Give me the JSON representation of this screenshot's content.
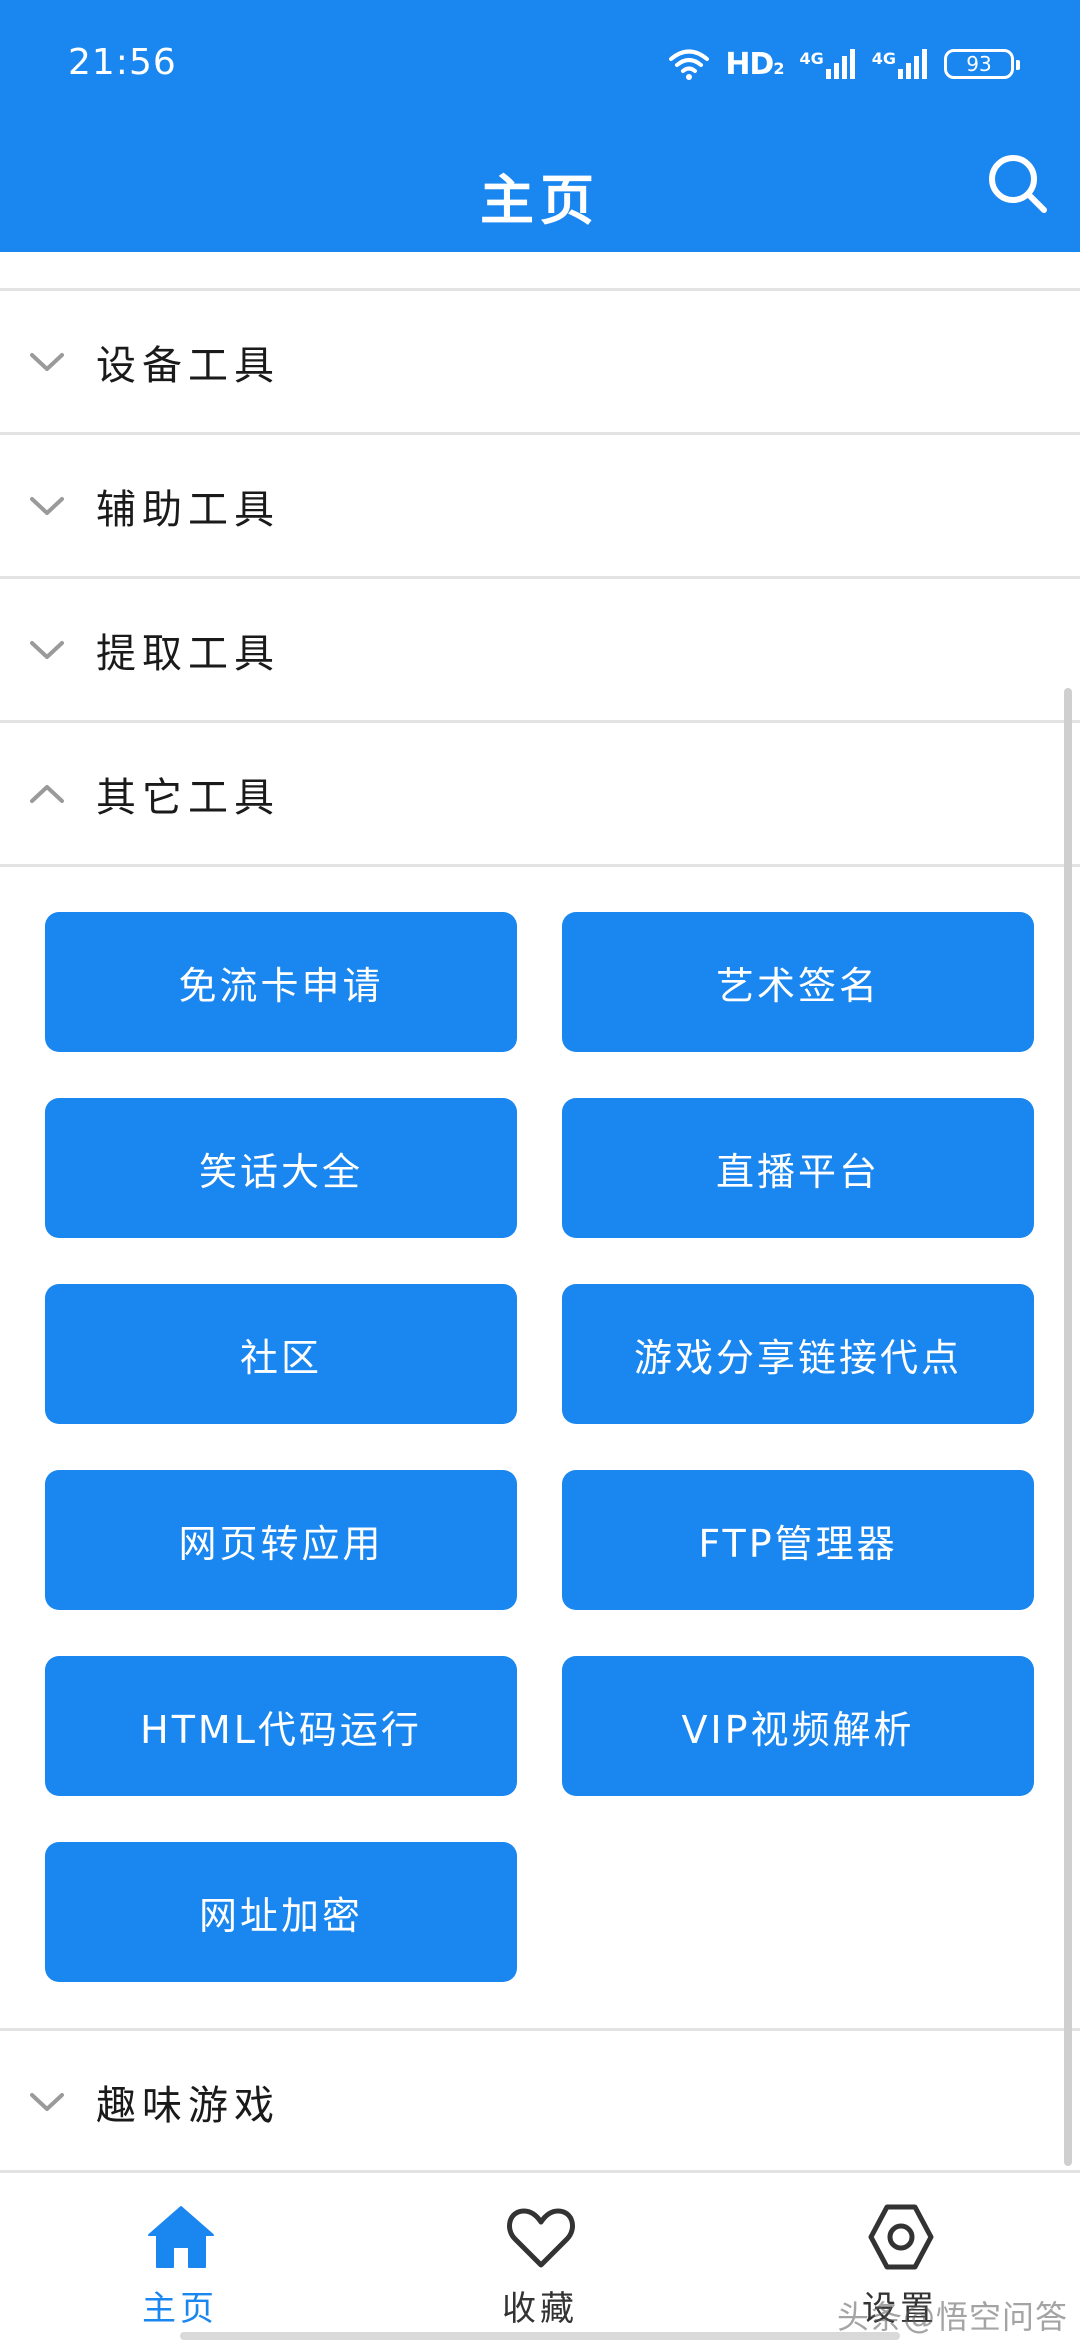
{
  "status_bar": {
    "time": "21:56",
    "network_label": "HD",
    "network_sub": "2",
    "signal_1": "4G",
    "signal_2": "4G",
    "battery": "93"
  },
  "header": {
    "title": "主页",
    "search_icon": "search-icon"
  },
  "sections": [
    {
      "title": "设备工具",
      "expanded": false
    },
    {
      "title": "辅助工具",
      "expanded": false
    },
    {
      "title": "提取工具",
      "expanded": false
    },
    {
      "title": "其它工具",
      "expanded": true
    },
    {
      "title": "趣味游戏",
      "expanded": false
    }
  ],
  "tools": [
    "免流卡申请",
    "艺术签名",
    "笑话大全",
    "直播平台",
    "社区",
    "游戏分享链接代点",
    "网页转应用",
    "FTP管理器",
    "HTML代码运行",
    "VIP视频解析",
    "网址加密"
  ],
  "bottom_nav": {
    "items": [
      {
        "label": "主页",
        "icon": "home-icon",
        "active": true
      },
      {
        "label": "收藏",
        "icon": "heart-icon",
        "active": false
      },
      {
        "label": "设置",
        "icon": "settings-icon",
        "active": false
      }
    ]
  },
  "watermark": "头条@悟空问答",
  "colors": {
    "accent": "#1a86f0",
    "divider": "#e3e3e3",
    "text": "#1a1a1a"
  }
}
